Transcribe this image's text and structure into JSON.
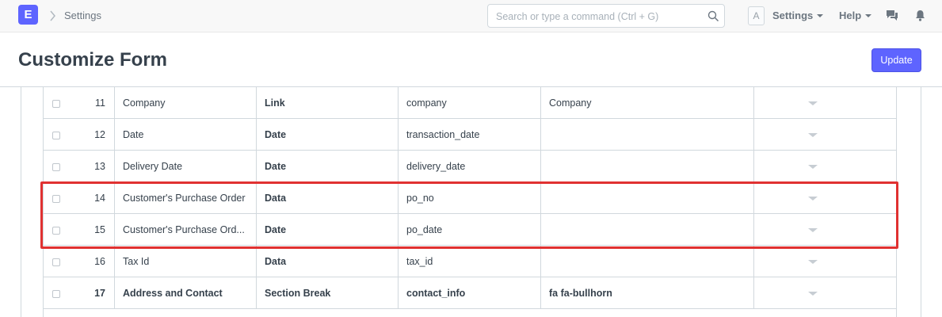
{
  "navbar": {
    "logo_letter": "E",
    "breadcrumb": "Settings",
    "search_placeholder": "Search or type a command (Ctrl + G)",
    "avatar_letter": "A",
    "settings_label": "Settings",
    "help_label": "Help"
  },
  "page": {
    "title": "Customize Form",
    "update_label": "Update"
  },
  "rows": [
    {
      "idx": "11",
      "label": "Company",
      "fieldtype": "Link",
      "fieldname": "company",
      "options": "Company"
    },
    {
      "idx": "12",
      "label": "Date",
      "fieldtype": "Date",
      "fieldname": "transaction_date",
      "options": ""
    },
    {
      "idx": "13",
      "label": "Delivery Date",
      "fieldtype": "Date",
      "fieldname": "delivery_date",
      "options": ""
    },
    {
      "idx": "14",
      "label": "Customer's Purchase Order",
      "fieldtype": "Data",
      "fieldname": "po_no",
      "options": ""
    },
    {
      "idx": "15",
      "label": "Customer's Purchase Ord...",
      "fieldtype": "Date",
      "fieldname": "po_date",
      "options": ""
    },
    {
      "idx": "16",
      "label": "Tax Id",
      "fieldtype": "Data",
      "fieldname": "tax_id",
      "options": ""
    },
    {
      "idx": "17",
      "label": "Address and Contact",
      "fieldtype": "Section Break",
      "fieldname": "contact_info",
      "options": "fa fa-bullhorn"
    }
  ],
  "colors": {
    "accent": "#5e64ff",
    "highlight": "#e03131"
  }
}
